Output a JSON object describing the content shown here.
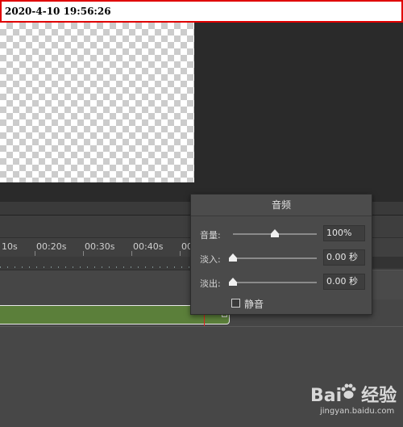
{
  "timestamp": "2020-4-10 19:56:26",
  "timeline": {
    "ticks": [
      "10s",
      "00:20s",
      "00:30s",
      "00:40s",
      "00"
    ]
  },
  "audio_panel": {
    "title": "音频",
    "volume": {
      "label": "音量:",
      "value": "100%",
      "level": 0.5
    },
    "fade_in": {
      "label": "淡入:",
      "value": "0.00 秒",
      "level": 0
    },
    "fade_out": {
      "label": "淡出:",
      "value": "0.00 秒",
      "level": 0
    },
    "mute": {
      "label": "静音",
      "checked": false
    }
  },
  "watermark": {
    "logo_left": "Bai",
    "logo_right": "经验",
    "url": "jingyan.baidu.com"
  },
  "colors": {
    "timestamp_border": "#e00000",
    "clip": "#5b7f3a",
    "playhead": "#e02020"
  }
}
